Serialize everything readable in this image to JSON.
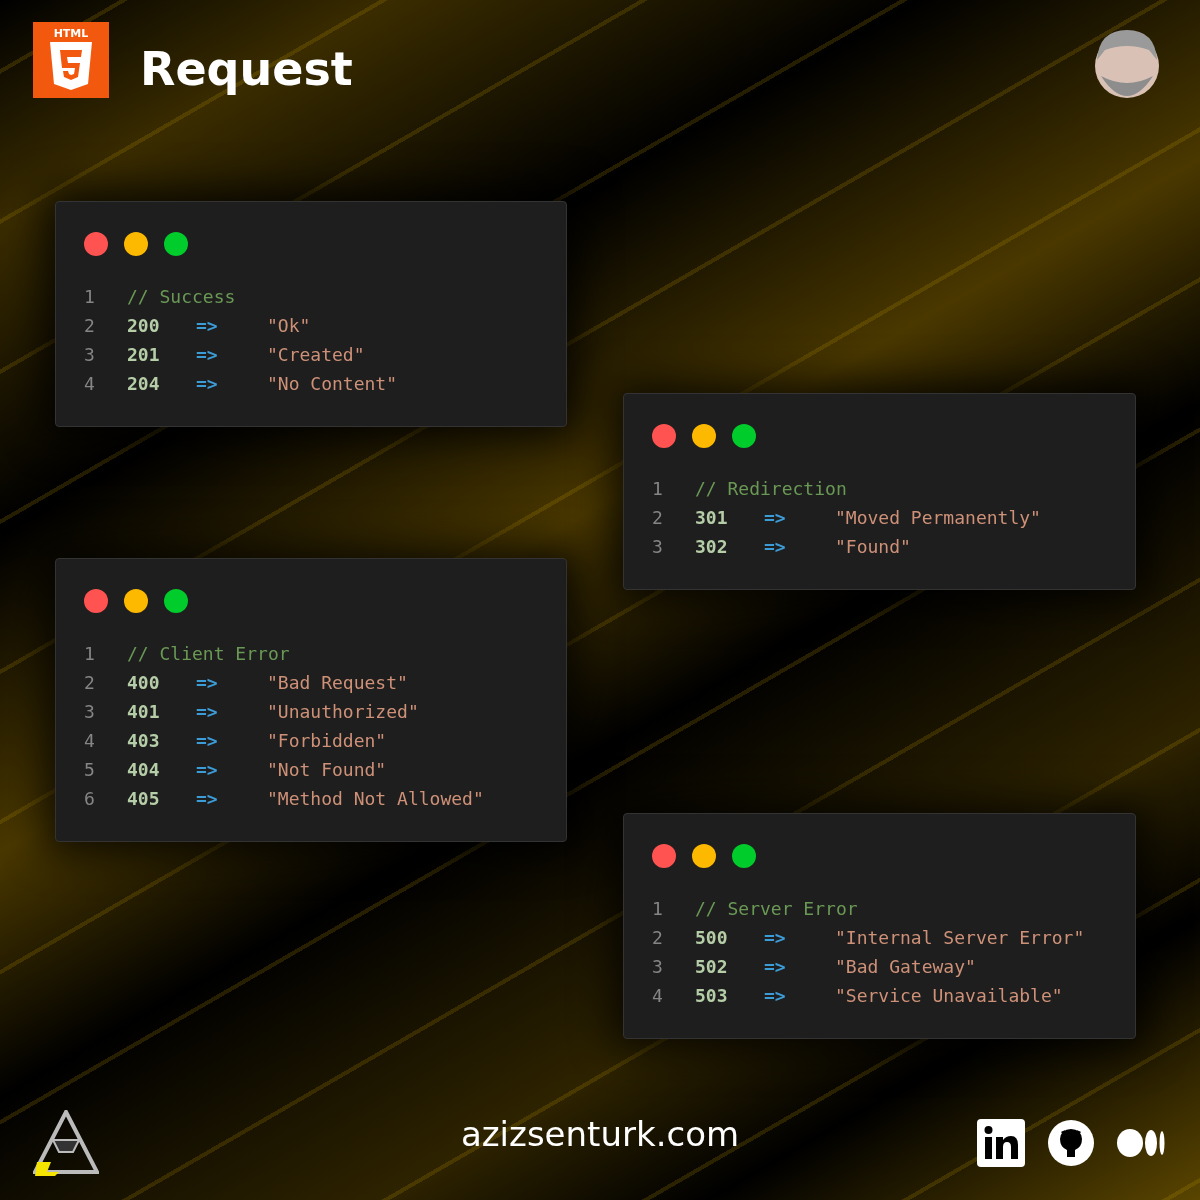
{
  "header": {
    "logo_text": "HTML",
    "title": "Request"
  },
  "columns": [
    [
      {
        "lines": [
          {
            "kind": "comment",
            "number": "1",
            "text": "// Success"
          },
          {
            "kind": "map",
            "number": "2",
            "code": "200",
            "arrow": "=>",
            "value": "\"Ok\""
          },
          {
            "kind": "map",
            "number": "3",
            "code": "201",
            "arrow": "=>",
            "value": "\"Created\""
          },
          {
            "kind": "map",
            "number": "4",
            "code": "204",
            "arrow": "=>",
            "value": "\"No Content\""
          }
        ]
      },
      {
        "lines": [
          {
            "kind": "comment",
            "number": "1",
            "text": "// Client Error"
          },
          {
            "kind": "map",
            "number": "2",
            "code": "400",
            "arrow": "=>",
            "value": "\"Bad Request\""
          },
          {
            "kind": "map",
            "number": "3",
            "code": "401",
            "arrow": "=>",
            "value": "\"Unauthorized\""
          },
          {
            "kind": "map",
            "number": "4",
            "code": "403",
            "arrow": "=>",
            "value": "\"Forbidden\""
          },
          {
            "kind": "map",
            "number": "5",
            "code": "404",
            "arrow": "=>",
            "value": "\"Not Found\""
          },
          {
            "kind": "map",
            "number": "6",
            "code": "405",
            "arrow": "=>",
            "value": "\"Method Not Allowed\""
          }
        ]
      }
    ],
    [
      {
        "lines": [
          {
            "kind": "comment",
            "number": "1",
            "text": "// Redirection"
          },
          {
            "kind": "map",
            "number": "2",
            "code": "301",
            "arrow": "=>",
            "value": "\"Moved Permanently\""
          },
          {
            "kind": "map",
            "number": "3",
            "code": "302",
            "arrow": "=>",
            "value": "\"Found\""
          }
        ]
      },
      {
        "lines": [
          {
            "kind": "comment",
            "number": "1",
            "text": "// Server Error"
          },
          {
            "kind": "map",
            "number": "2",
            "code": "500",
            "arrow": "=>",
            "value": "\"Internal Server Error\""
          },
          {
            "kind": "map",
            "number": "3",
            "code": "502",
            "arrow": "=>",
            "value": "\"Bad Gateway\""
          },
          {
            "kind": "map",
            "number": "4",
            "code": "503",
            "arrow": "=>",
            "value": "\"Service Unavailable\""
          }
        ]
      }
    ]
  ],
  "footer": {
    "url": "azizsenturk.com"
  }
}
